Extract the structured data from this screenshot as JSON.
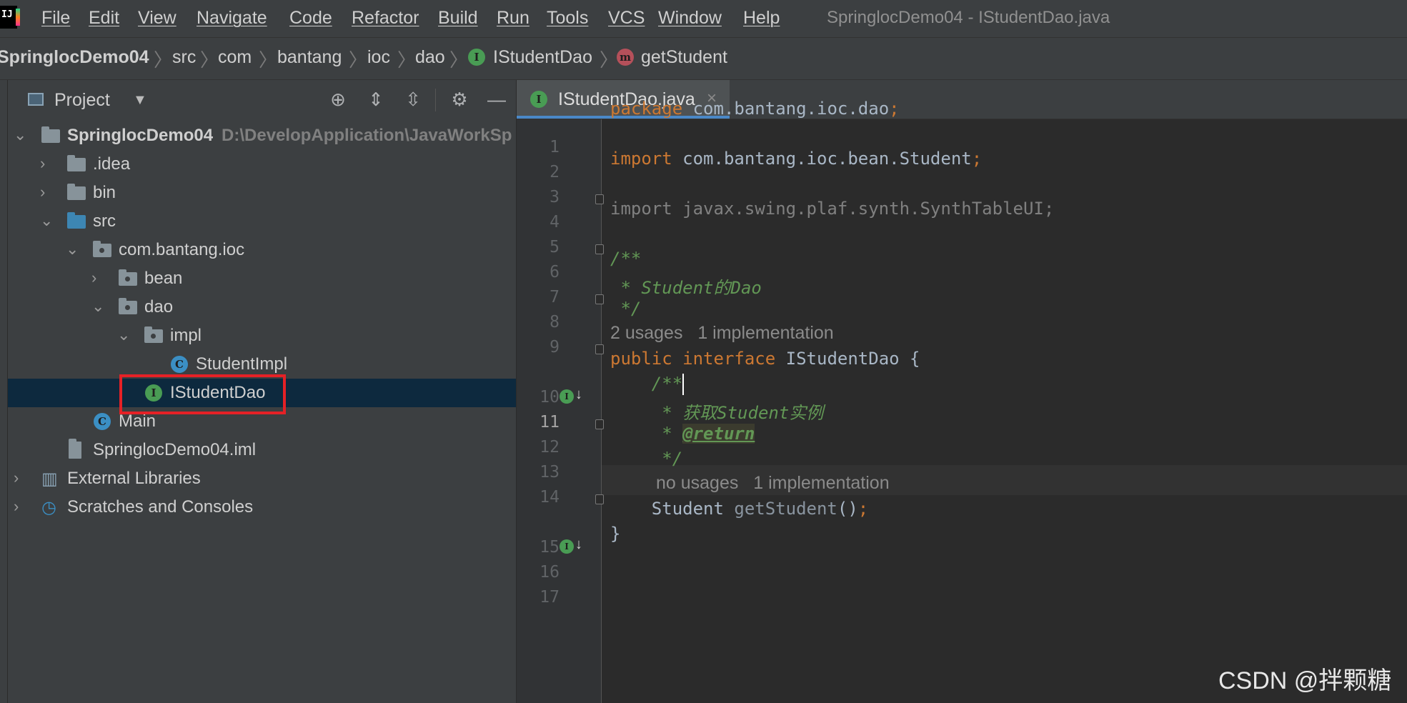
{
  "menubar": {
    "items": [
      "File",
      "Edit",
      "View",
      "Navigate",
      "Code",
      "Refactor",
      "Build",
      "Run",
      "Tools",
      "VCS",
      "Window",
      "Help"
    ],
    "window_title": "SpringlocDemo04 - IStudentDao.java"
  },
  "breadcrumb": {
    "items": [
      "SpringlocDemo04",
      "src",
      "com",
      "bantang",
      "ioc",
      "dao",
      "IStudentDao",
      "getStudent"
    ]
  },
  "project_panel": {
    "title": "Project",
    "tree": [
      {
        "label": "SpringlocDemo04",
        "path": "D:\\DevelopApplication\\JavaWorkSp"
      },
      {
        "label": ".idea"
      },
      {
        "label": "bin"
      },
      {
        "label": "src"
      },
      {
        "label": "com.bantang.ioc"
      },
      {
        "label": "bean"
      },
      {
        "label": "dao"
      },
      {
        "label": "impl"
      },
      {
        "label": "StudentImpl"
      },
      {
        "label": "IStudentDao"
      },
      {
        "label": "Main"
      },
      {
        "label": "SpringlocDemo04.iml"
      },
      {
        "label": "External Libraries"
      },
      {
        "label": "Scratches and Consoles"
      }
    ]
  },
  "editor": {
    "tab_label": "IStudentDao.java",
    "line_numbers": [
      "1",
      "2",
      "3",
      "4",
      "5",
      "6",
      "7",
      "8",
      "9",
      "10",
      "11",
      "12",
      "13",
      "14",
      "15",
      "16",
      "17"
    ],
    "code": {
      "l1_kw": "package",
      "l1_rest": " com.bantang.ioc.dao",
      "l3_kw": "import",
      "l3_rest": " com.bantang.ioc.bean.Student",
      "l5": "import javax.swing.plaf.synth.SynthTableUI;",
      "l7": "/**",
      "l8": " * Student的Dao",
      "l9": " */",
      "hint_usages": "2 usages",
      "hint_impl": "1 implementation",
      "l10_kw1": "public",
      "l10_kw2": "interface",
      "l10_rest": " IStudentDao {",
      "l11": "    /**",
      "l12": "     * 获取Student实例",
      "l13_prefix": "     * ",
      "l13_tag": "@return",
      "l14": "     */",
      "hint2_usages": "no usages",
      "hint2_impl": "1 implementation",
      "l15_type": "    Student ",
      "l15_method": "getStudent",
      "l15_end": "()",
      "l16": "}",
      "semicolon": ";"
    }
  },
  "watermark": "CSDN @拌颗糖",
  "colors": {
    "keyword": "#cc7832",
    "doc_comment": "#629755",
    "selection": "#0d293e",
    "highlight_box": "#e52126"
  }
}
